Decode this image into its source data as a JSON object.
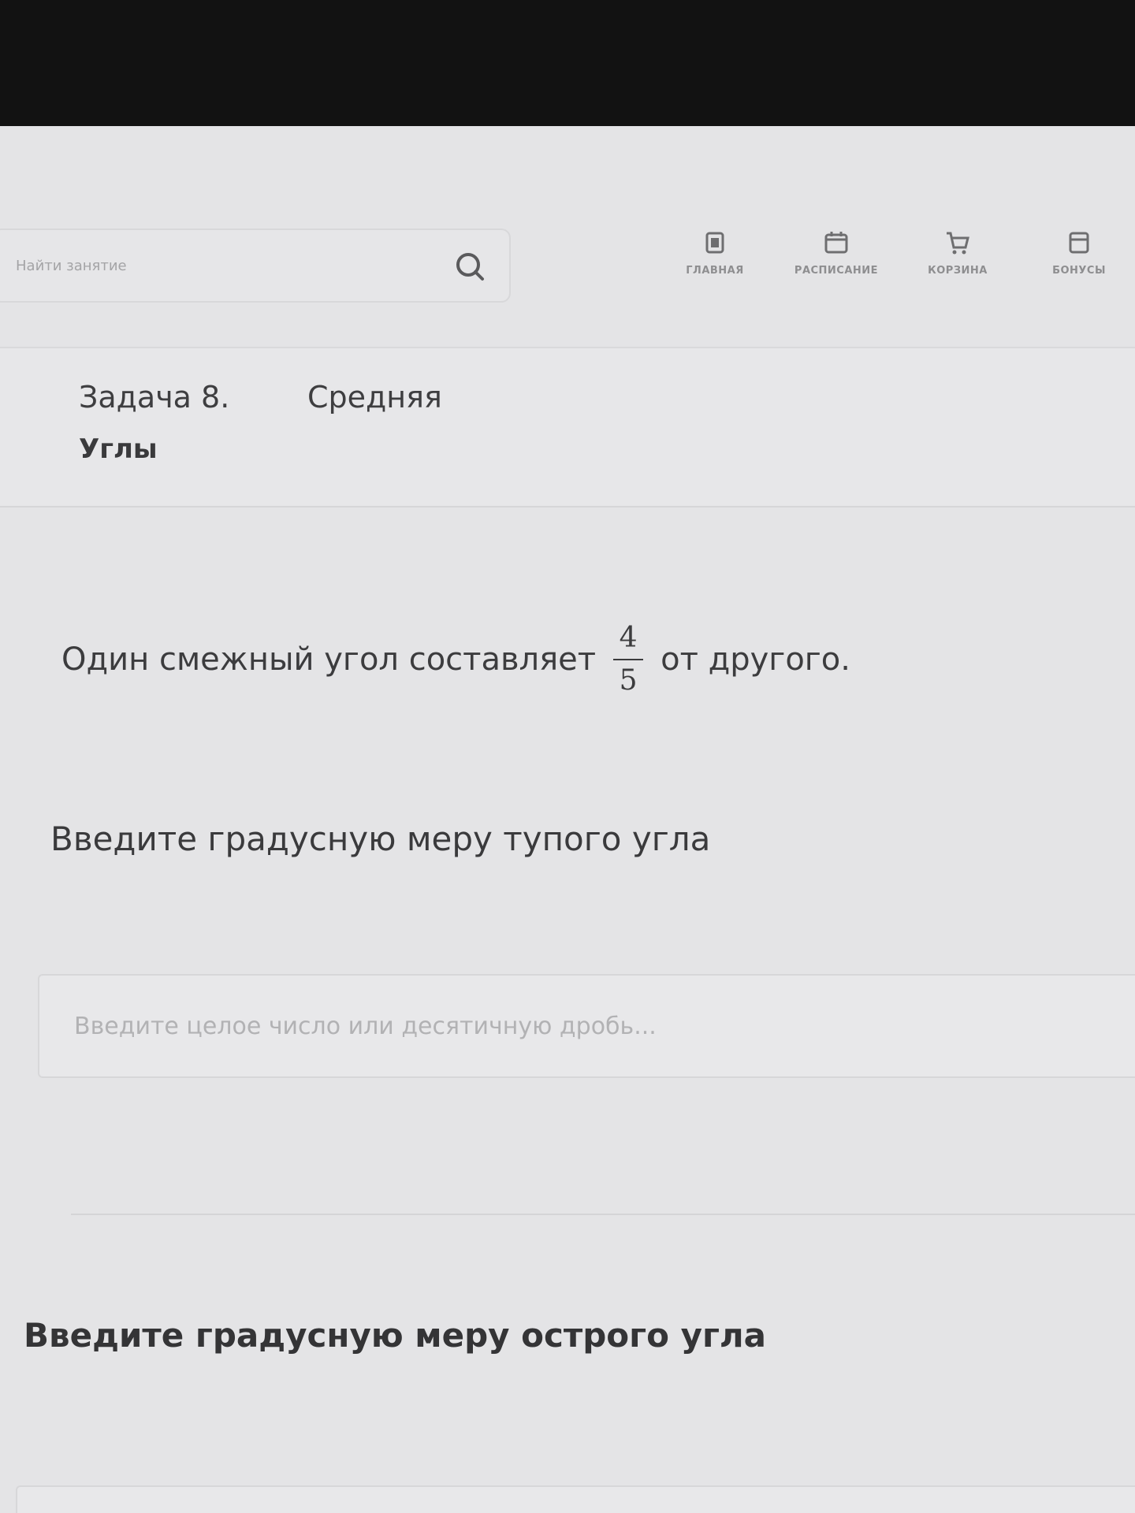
{
  "search": {
    "placeholder": "Найти занятие"
  },
  "nav": {
    "items": [
      {
        "label": "ГЛАВНАЯ",
        "icon": "home-icon"
      },
      {
        "label": "РАСПИСАНИЕ",
        "icon": "calendar-icon"
      },
      {
        "label": "КОРЗИНА",
        "icon": "cart-icon"
      },
      {
        "label": "БОНУСЫ",
        "icon": "bonus-icon"
      }
    ]
  },
  "task": {
    "number": "Задача 8.",
    "level": "Средняя",
    "topic": "Углы"
  },
  "problem": {
    "before": "Один смежный угол составляет",
    "numerator": "4",
    "denominator": "5",
    "after": "от другого."
  },
  "questions": {
    "obtuse": "Введите градусную меру тупого угла",
    "acute": "Введите градусную меру острого угла"
  },
  "answer_input": {
    "placeholder": "Введите целое число или десятичную дробь...",
    "value": ""
  }
}
